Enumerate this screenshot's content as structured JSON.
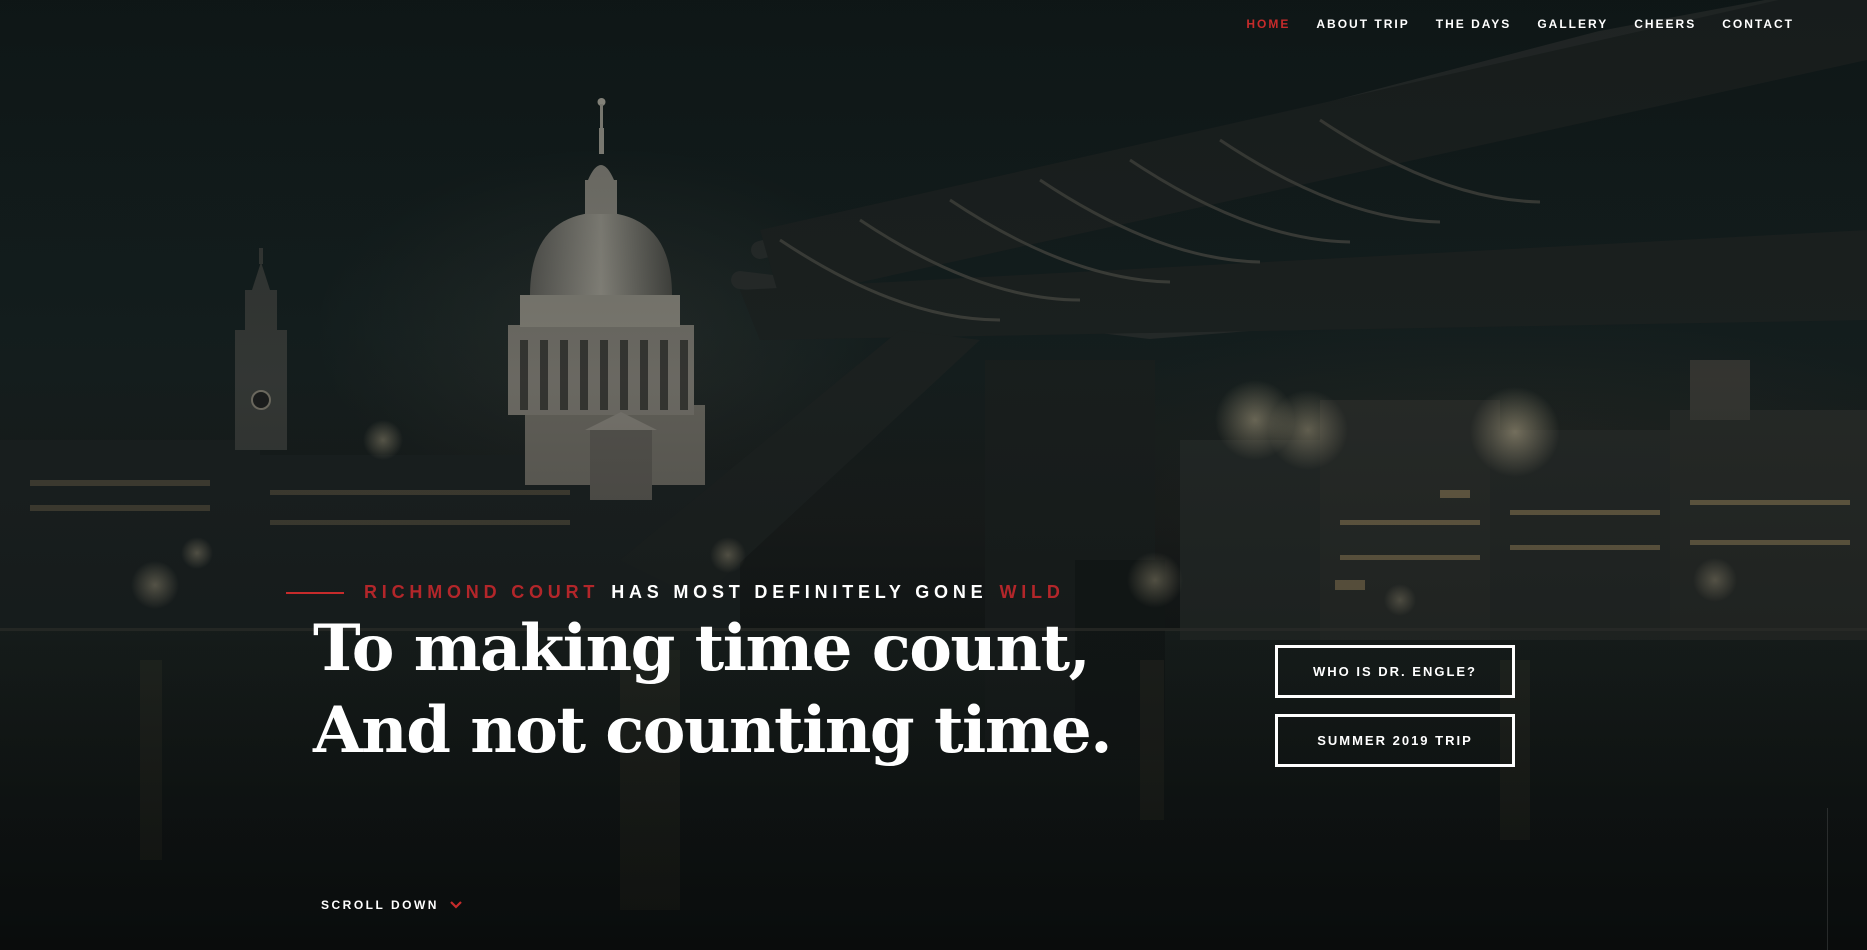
{
  "nav": {
    "items": [
      {
        "label": "HOME",
        "active": true
      },
      {
        "label": "ABOUT TRIP",
        "active": false
      },
      {
        "label": "THE DAYS",
        "active": false
      },
      {
        "label": "GALLERY",
        "active": false
      },
      {
        "label": "CHEERS",
        "active": false
      },
      {
        "label": "CONTACT",
        "active": false
      }
    ]
  },
  "hero": {
    "tagline_part1": "RICHMOND COURT",
    "tagline_part2": "HAS MOST DEFINITELY GONE",
    "tagline_part3": "WILD",
    "headline_line1": "To making time count,",
    "headline_line2": "And not counting time."
  },
  "cta": {
    "primary_label": "WHO IS DR. ENGLE?",
    "secondary_label": "SUMMER 2019 TRIP"
  },
  "scroll": {
    "label": "SCROLL DOWN",
    "icon": "chevron-down-icon"
  },
  "colors": {
    "accent": "#c62b2b",
    "background": "#111818",
    "text": "#ffffff"
  }
}
